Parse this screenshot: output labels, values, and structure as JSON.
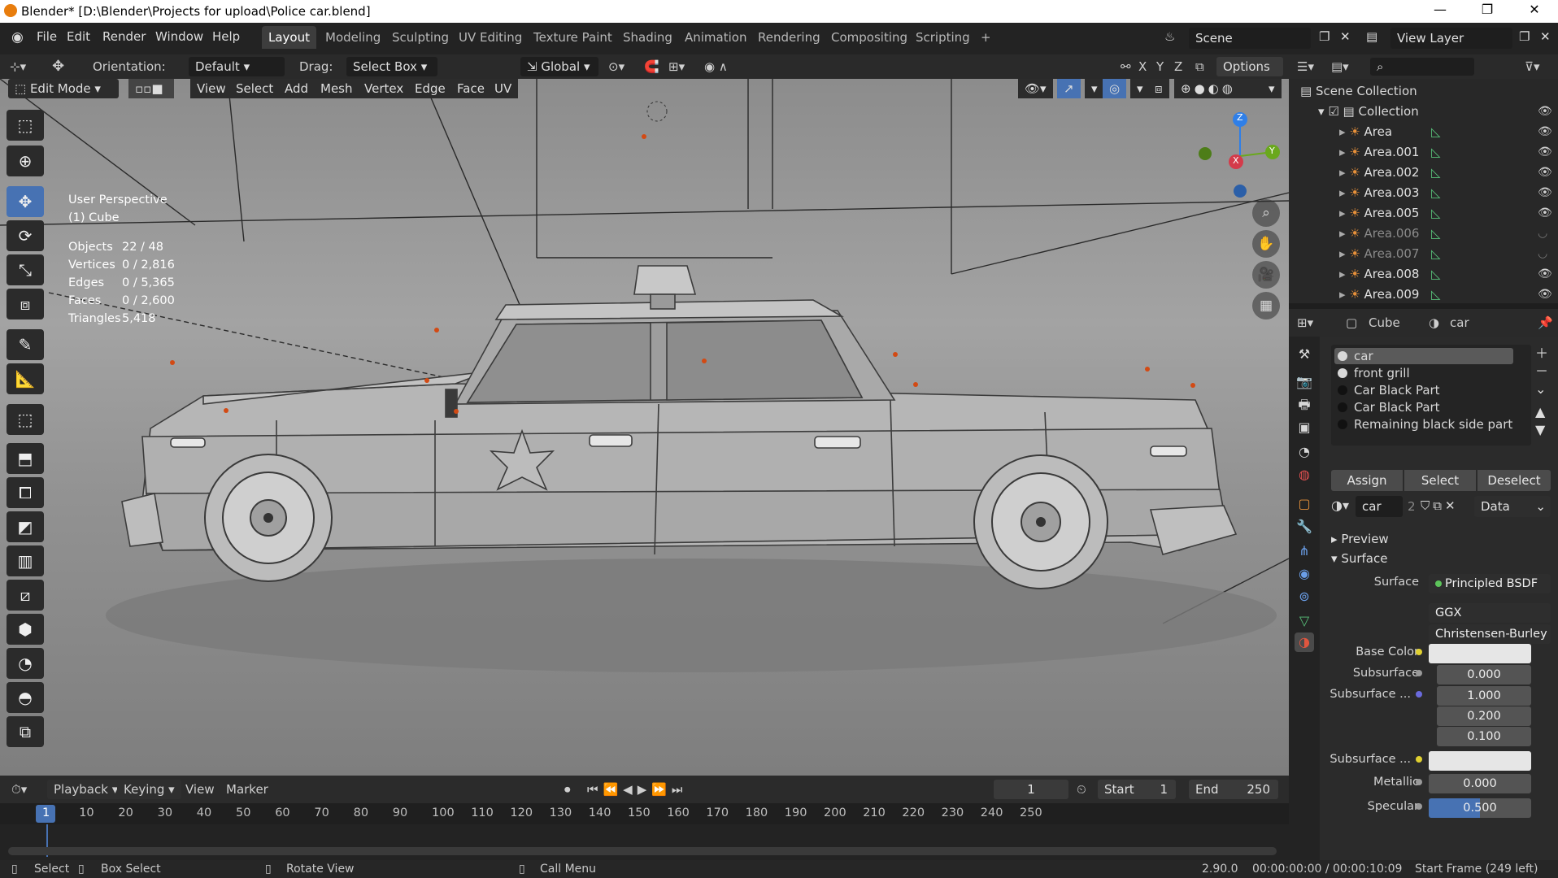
{
  "window": {
    "title": "Blender* [D:\\Blender\\Projects for upload\\Police car.blend]",
    "controls": [
      "—",
      "❐",
      "✕"
    ]
  },
  "menu": {
    "items": [
      "File",
      "Edit",
      "Render",
      "Window",
      "Help"
    ],
    "workspaces": [
      "Layout",
      "Modeling",
      "Sculpting",
      "UV Editing",
      "Texture Paint",
      "Shading",
      "Animation",
      "Rendering",
      "Compositing",
      "Scripting"
    ],
    "active_workspace": "Layout",
    "add_tab": "+",
    "scene": "Scene",
    "view_layer": "View Layer"
  },
  "tool_header": {
    "orientation_label": "Orientation:",
    "orientation_value": "Default",
    "drag_label": "Drag:",
    "drag_value": "Select Box",
    "transform_orientation": "Global",
    "axes": [
      "X",
      "Y",
      "Z"
    ],
    "options": "Options"
  },
  "viewport_header": {
    "mode": "Edit Mode",
    "menus": [
      "View",
      "Select",
      "Add",
      "Mesh",
      "Vertex",
      "Edge",
      "Face",
      "UV"
    ]
  },
  "viewport": {
    "perspective": "User Perspective",
    "object": "(1) Cube",
    "stats": [
      {
        "label": "Objects",
        "value": "22 / 48"
      },
      {
        "label": "Vertices",
        "value": "0 / 2,816"
      },
      {
        "label": "Edges",
        "value": "0 / 5,365"
      },
      {
        "label": "Faces",
        "value": "0 / 2,600"
      },
      {
        "label": "Triangles",
        "value": "5,418"
      }
    ],
    "gizmo": {
      "z": "Z",
      "y": "Y",
      "x": "X"
    }
  },
  "toolbar": {
    "tools": [
      "select-box-tool",
      "cursor-tool",
      "move-tool",
      "rotate-tool",
      "scale-tool",
      "transform-tool",
      "annotate-tool",
      "measure-tool",
      "add-cube-tool",
      "extrude-tool",
      "inset-tool",
      "bevel-tool",
      "loop-cut-tool",
      "knife-tool",
      "poly-build-tool",
      "spin-tool",
      "smooth-tool",
      "edge-slide-tool",
      "shrink-fatten-tool"
    ],
    "active_index": 2
  },
  "timeline": {
    "menus": [
      "Playback",
      "Keying",
      "View",
      "Marker"
    ],
    "current_frame": "1",
    "start_label": "Start",
    "start_value": "1",
    "end_label": "End",
    "end_value": "250",
    "ticks": [
      "1",
      "10",
      "20",
      "30",
      "40",
      "50",
      "60",
      "70",
      "80",
      "90",
      "100",
      "110",
      "120",
      "130",
      "140",
      "150",
      "160",
      "170",
      "180",
      "190",
      "200",
      "210",
      "220",
      "230",
      "240",
      "250"
    ]
  },
  "status": {
    "select": "Select",
    "box_select": "Box Select",
    "rotate_view": "Rotate View",
    "call_menu": "Call Menu",
    "version": "2.90.0",
    "time": "00:00:00:00 / 00:00:10:09",
    "start_frame": "Start Frame (249 left)"
  },
  "outliner": {
    "root": "Scene Collection",
    "collection": "Collection",
    "items": [
      {
        "name": "Area",
        "dim": false
      },
      {
        "name": "Area.001",
        "dim": false
      },
      {
        "name": "Area.002",
        "dim": false
      },
      {
        "name": "Area.003",
        "dim": false
      },
      {
        "name": "Area.005",
        "dim": false
      },
      {
        "name": "Area.006",
        "dim": true
      },
      {
        "name": "Area.007",
        "dim": true
      },
      {
        "name": "Area.008",
        "dim": false
      },
      {
        "name": "Area.009",
        "dim": false
      }
    ]
  },
  "properties": {
    "object": "Cube",
    "material": "car",
    "slots": [
      "car",
      "front grill",
      "Car Black Part",
      "Car Black Part",
      "Remaining black side part"
    ],
    "buttons": {
      "assign": "Assign",
      "select": "Select",
      "deselect": "Deselect"
    },
    "material_name": "car",
    "users": "2",
    "link": "Data",
    "preview_panel": "Preview",
    "surface_panel": "Surface",
    "surface_label": "Surface",
    "surface_value": "Principled BSDF",
    "distribution": "GGX",
    "subsurface_method": "Christensen-Burley",
    "fields": {
      "base_color": "Base Color",
      "subsurface": "Subsurface",
      "subsurface_value": "0.000",
      "subsurface_radius": "Subsurface ...",
      "radius_1": "1.000",
      "radius_2": "0.200",
      "radius_3": "0.100",
      "subsurface_color": "Subsurface ...",
      "metallic": "Metallic",
      "metallic_value": "0.000",
      "specular": "Specular",
      "specular_value": "0.500"
    }
  },
  "colors": {
    "accent": "#4772b3",
    "orange": "#e87d0d"
  }
}
